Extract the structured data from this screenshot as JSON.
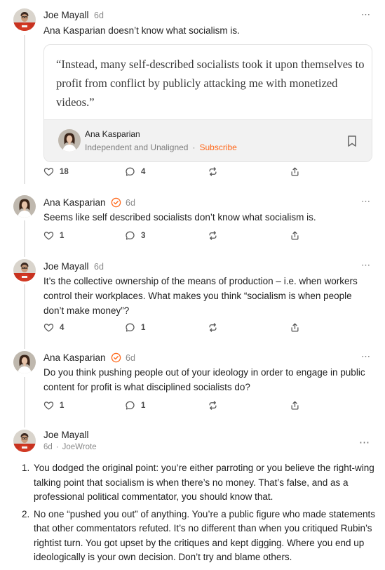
{
  "posts": [
    {
      "author": "Joe Mayall",
      "time": "6d",
      "text": "Ana Kasparian doesn’t know what socialism is.",
      "quote": {
        "text": "“Instead, many self-described socialists took it upon themselves to profit from conflict by publicly attacking me with monetized videos.”",
        "author": "Ana Kasparian",
        "publication": "Independent and Unaligned",
        "separator": "·",
        "subscribe_label": "Subscribe"
      },
      "likes": "18",
      "comments": "4"
    },
    {
      "author": "Ana Kasparian",
      "time": "6d",
      "text": "Seems like self described socialists don’t know what socialism is.",
      "likes": "1",
      "comments": "3"
    },
    {
      "author": "Joe Mayall",
      "time": "6d",
      "text": "It’s the collective ownership of the means of production – i.e. when workers control their workplaces. What makes you think “socialism is when people don’t make money”?",
      "likes": "4",
      "comments": "1"
    },
    {
      "author": "Ana Kasparian",
      "time": "6d",
      "text": "Do you think pushing people out of your ideology in order to engage in public content for profit is what disciplined socialists do?",
      "likes": "1",
      "comments": "1"
    },
    {
      "author": "Joe Mayall",
      "time": "6d",
      "separator": "·",
      "publication": "JoeWrote",
      "points": [
        "You dodged the original point: you’re either parroting or you believe the right-wing talking point that socialism is when there’s no money. That’s false, and as a professional political commentator, you should know that.",
        "No one “pushed you out” of anything. You’re a public figure who made statements that other commentators refuted. It’s no different than when you critiqued Rubin’s rightist turn. You got upset by the critiques and kept digging. Where you end up ideologically is your own decision. Don’t try and blame others."
      ]
    }
  ],
  "icons": {
    "more": "⋯",
    "like": "heart-icon",
    "comment": "comment-bubble-icon",
    "restack": "restack-icon",
    "share": "share-icon",
    "bookmark": "bookmark-icon",
    "verified": "verified-check-icon"
  },
  "colors": {
    "accent": "#ff6719",
    "text": "#1f1f1f",
    "muted": "#8a8a8a"
  }
}
